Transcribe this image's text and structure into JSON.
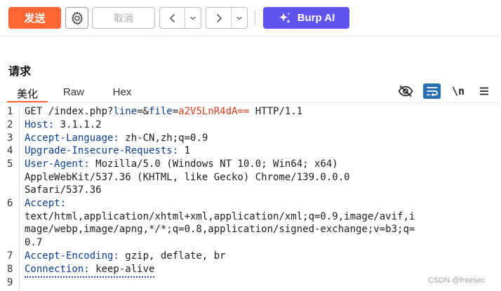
{
  "toolbar": {
    "send_label": "发送",
    "cancel_label": "取消",
    "burp_ai_label": "Burp AI"
  },
  "request": {
    "title": "请求",
    "tabs": [
      "美化",
      "Raw",
      "Hex"
    ],
    "active_tab": "美化",
    "newline_toggle_label": "\\n"
  },
  "lines": [
    {
      "num": "1",
      "method": "GET ",
      "path": "/index.php?",
      "p1": "line",
      "eq1": "=&",
      "p2": "file",
      "eq2": "=",
      "p2val": "a2V5LnR4dA==",
      "proto": " HTTP/1.1"
    },
    {
      "num": "2",
      "key": "Host:",
      "value": " 3.1.1.2"
    },
    {
      "num": "3",
      "key": "Accept-Language:",
      "value": " zh-CN,zh;q=0.9"
    },
    {
      "num": "4",
      "key": "Upgrade-Insecure-Requests:",
      "value": " 1"
    },
    {
      "num": "5",
      "key": "User-Agent:",
      "value": " Mozilla/5.0 (Windows NT 10.0; Win64; x64)",
      "wrap": [
        "AppleWebKit/537.36 (KHTML, like Gecko) Chrome/139.0.0.0",
        "Safari/537.36"
      ]
    },
    {
      "num": "6",
      "key": "Accept:",
      "value": "",
      "wrap": [
        "text/html,application/xhtml+xml,application/xml;q=0.9,image/avif,i",
        "mage/webp,image/apng,*/*;q=0.8,application/signed-exchange;v=b3;q=",
        "0.7"
      ]
    },
    {
      "num": "7",
      "key": "Accept-Encoding:",
      "value": " gzip, deflate, br"
    },
    {
      "num": "8",
      "key": "Connection:",
      "value": " keep-alive"
    },
    {
      "num": "9"
    }
  ],
  "watermark": "CSDN @freesec",
  "colors": {
    "send": "#ff6633",
    "burp_ai": "#6054f0",
    "header_key": "#0b3d91",
    "param": "#d63a16",
    "wrap_toggle": "#2a6fb0"
  },
  "icons": [
    "gear-icon",
    "chevron-left-icon",
    "chevron-right-icon",
    "chevron-down-icon",
    "sparkle-icon",
    "eye-off-icon",
    "wrap-lines-icon",
    "menu-icon"
  ]
}
